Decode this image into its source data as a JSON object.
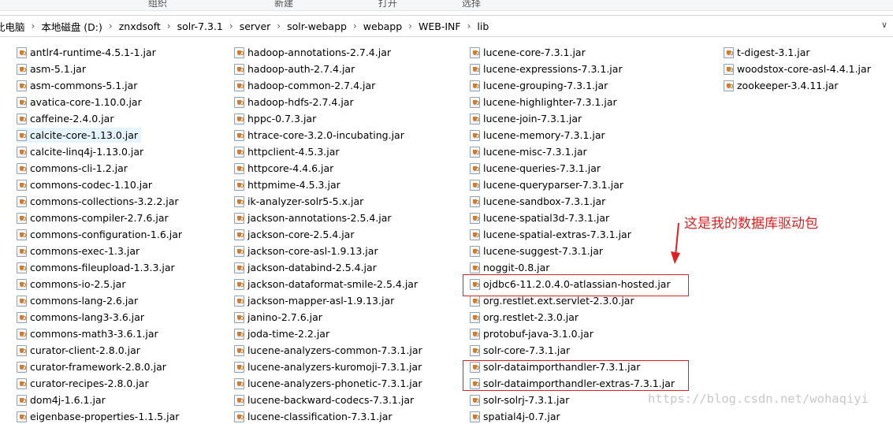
{
  "ribbon": {
    "groups": [
      "组织",
      "新建",
      "打开",
      "选择"
    ]
  },
  "address": {
    "crumbs": [
      "此电脑",
      "本地磁盘 (D:)",
      "znxdsoft",
      "solr-7.3.1",
      "server",
      "solr-webapp",
      "webapp",
      "WEB-INF",
      "lib"
    ]
  },
  "files": {
    "columns": [
      [
        "antlr4-runtime-4.5.1-1.jar",
        "asm-5.1.jar",
        "asm-commons-5.1.jar",
        "avatica-core-1.10.0.jar",
        "caffeine-2.4.0.jar",
        "calcite-core-1.13.0.jar",
        "calcite-linq4j-1.13.0.jar",
        "commons-cli-1.2.jar",
        "commons-codec-1.10.jar",
        "commons-collections-3.2.2.jar",
        "commons-compiler-2.7.6.jar",
        "commons-configuration-1.6.jar",
        "commons-exec-1.3.jar",
        "commons-fileupload-1.3.3.jar",
        "commons-io-2.5.jar",
        "commons-lang-2.6.jar",
        "commons-lang3-3.6.jar",
        "commons-math3-3.6.1.jar",
        "curator-client-2.8.0.jar",
        "curator-framework-2.8.0.jar",
        "curator-recipes-2.8.0.jar",
        "dom4j-1.6.1.jar",
        "eigenbase-properties-1.1.5.jar"
      ],
      [
        "hadoop-annotations-2.7.4.jar",
        "hadoop-auth-2.7.4.jar",
        "hadoop-common-2.7.4.jar",
        "hadoop-hdfs-2.7.4.jar",
        "hppc-0.7.3.jar",
        "htrace-core-3.2.0-incubating.jar",
        "httpclient-4.5.3.jar",
        "httpcore-4.4.6.jar",
        "httpmime-4.5.3.jar",
        "ik-analyzer-solr5-5.x.jar",
        "jackson-annotations-2.5.4.jar",
        "jackson-core-2.5.4.jar",
        "jackson-core-asl-1.9.13.jar",
        "jackson-databind-2.5.4.jar",
        "jackson-dataformat-smile-2.5.4.jar",
        "jackson-mapper-asl-1.9.13.jar",
        "janino-2.7.6.jar",
        "joda-time-2.2.jar",
        "lucene-analyzers-common-7.3.1.jar",
        "lucene-analyzers-kuromoji-7.3.1.jar",
        "lucene-analyzers-phonetic-7.3.1.jar",
        "lucene-backward-codecs-7.3.1.jar",
        "lucene-classification-7.3.1.jar"
      ],
      [
        "lucene-core-7.3.1.jar",
        "lucene-expressions-7.3.1.jar",
        "lucene-grouping-7.3.1.jar",
        "lucene-highlighter-7.3.1.jar",
        "lucene-join-7.3.1.jar",
        "lucene-memory-7.3.1.jar",
        "lucene-misc-7.3.1.jar",
        "lucene-queries-7.3.1.jar",
        "lucene-queryparser-7.3.1.jar",
        "lucene-sandbox-7.3.1.jar",
        "lucene-spatial3d-7.3.1.jar",
        "lucene-spatial-extras-7.3.1.jar",
        "lucene-suggest-7.3.1.jar",
        "noggit-0.8.jar",
        "ojdbc6-11.2.0.4.0-atlassian-hosted.jar",
        "org.restlet.ext.servlet-2.3.0.jar",
        "org.restlet-2.3.0.jar",
        "protobuf-java-3.1.0.jar",
        "solr-core-7.3.1.jar",
        "solr-dataimporthandler-7.3.1.jar",
        "solr-dataimporthandler-extras-7.3.1.jar",
        "solr-solrj-7.3.1.jar",
        "spatial4j-0.7.jar"
      ],
      [
        "t-digest-3.1.jar",
        "woodstox-core-asl-4.4.1.jar",
        "zookeeper-3.4.11.jar"
      ]
    ]
  },
  "annotation": {
    "text": "这是我的数据库驱动包",
    "color": "#e02020"
  },
  "watermark": {
    "text": "https://blog.csdn.net/wohaqiyi"
  }
}
